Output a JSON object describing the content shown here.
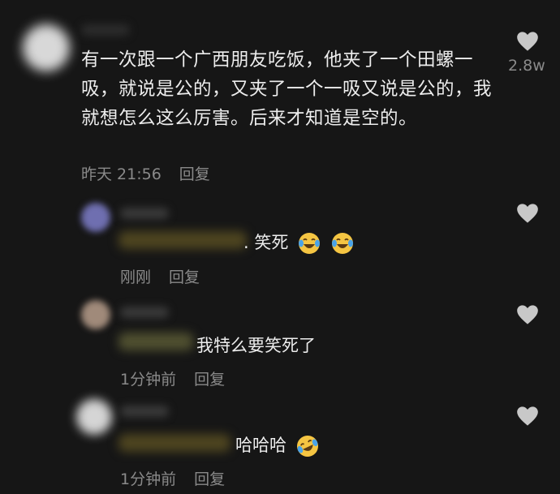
{
  "comment": {
    "text": "有一次跟一个广西朋友吃饭，他夹了一个田螺一吸，就说是公的，又夹了一个一吸又说是公的，我就想怎么这么厉害。后来才知道是空的。",
    "time": "昨天 21:56",
    "reply_label": "回复",
    "like_count": "2.8w"
  },
  "replies": [
    {
      "text": ". 笑死",
      "time": "刚刚",
      "reply_label": "回复",
      "emoji": "laughing-tears-icon x2"
    },
    {
      "text": "我特么要笑死了",
      "time": "1分钟前",
      "reply_label": "回复"
    },
    {
      "text": "哈哈哈",
      "time": "1分钟前",
      "reply_label": "回复",
      "emoji": "rolling-laughing-icon"
    }
  ],
  "colors": {
    "background": "#161616",
    "text": "#ededed",
    "meta": "#8a8a8a",
    "heart": "#c8c8c8",
    "emoji": "#f5c542"
  }
}
